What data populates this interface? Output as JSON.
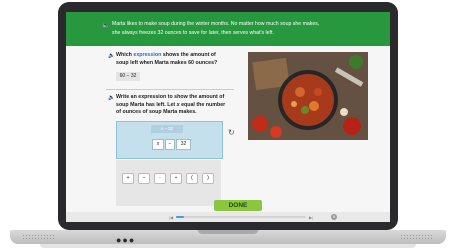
{
  "banner": {
    "line1": "Marta likes to make soup during the winter months. No matter how much soup she makes,",
    "line2": "she always freezes 32 ounces to save for later, then serves what's left.",
    "speaker_icon": "speaker-icon"
  },
  "question1": {
    "pre": "Which ",
    "keyword": "expression",
    "post": " shows the amount of soup left when Marta makes 60 ounces?",
    "answer": "60 − 32"
  },
  "question2": {
    "pre": "Write an expression to show the amount of soup Marta has left. Let ",
    "var": "x",
    "post": " equal the number of ounces of soup Marta makes."
  },
  "workspace": {
    "hint": "x − 32",
    "tokens": [
      "x",
      "−",
      "32"
    ]
  },
  "keypad": [
    "+",
    "−",
    "·",
    "÷",
    "(",
    ")"
  ],
  "done_label": "DONE",
  "progress": {
    "fraction": 0.06
  },
  "colors": {
    "banner": "#27983e",
    "done": "#8cc63f",
    "accent": "#2a6fd6"
  }
}
